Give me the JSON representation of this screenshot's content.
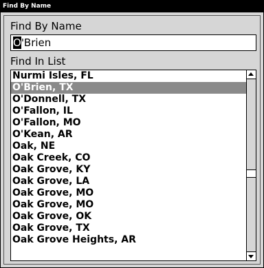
{
  "window": {
    "title": "Find By Name"
  },
  "find_by_name": {
    "label": "Find By Name",
    "value_first_char": "O",
    "value_rest": "'Brien"
  },
  "find_in_list": {
    "label": "Find In List",
    "items": [
      "Nurmi Isles, FL",
      "O'Brien, TX",
      "O'Donnell, TX",
      "O'Fallon, IL",
      "O'Fallon, MO",
      "O'Kean, AR",
      "Oak, NE",
      "Oak Creek, CO",
      "Oak Grove, KY",
      "Oak Grove, LA",
      "Oak Grove, MO",
      "Oak Grove, MO",
      "Oak Grove, OK",
      "Oak Grove, TX",
      "Oak Grove Heights, AR"
    ],
    "selected_index": 1,
    "scroll_position": 0.55
  },
  "colors": {
    "titlebar_bg": "#000000",
    "panel_bg": "#d6d6d6",
    "selection_bg": "#8a8a8a"
  },
  "icons": {
    "scroll_up": "arrow-up-icon",
    "scroll_down": "arrow-down-icon"
  }
}
